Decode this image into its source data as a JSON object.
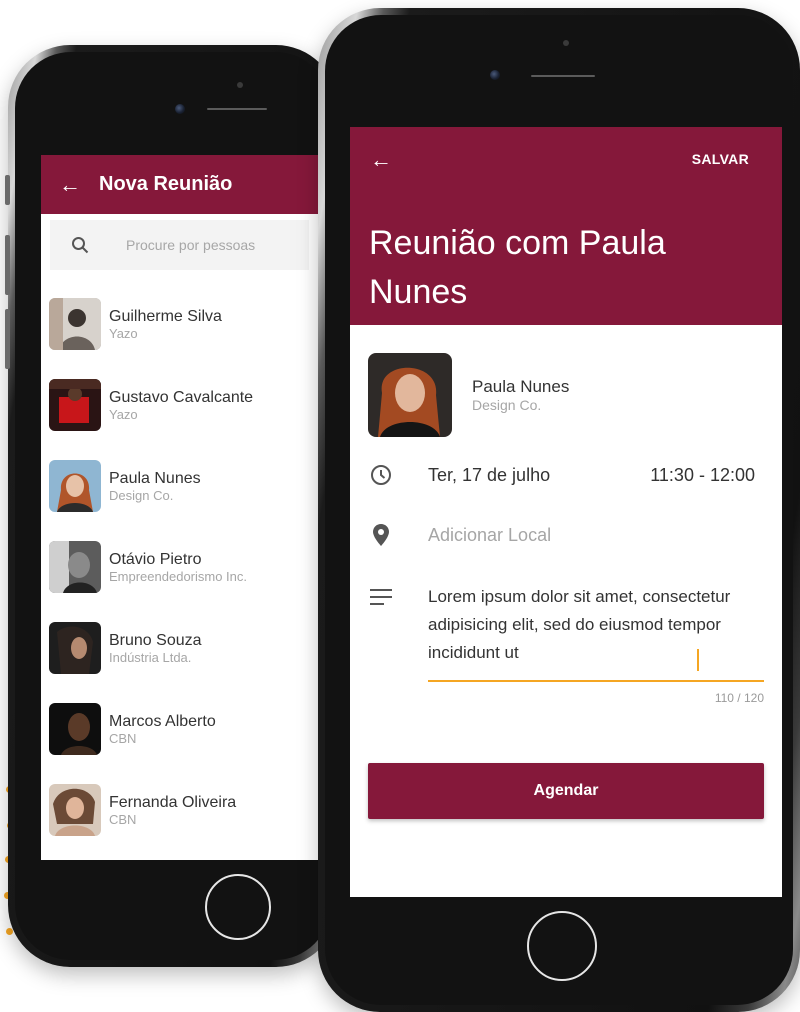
{
  "left_screen": {
    "title": "Nova Reunião",
    "search": {
      "placeholder": "Procure por pessoas"
    },
    "contacts": [
      {
        "name": "Guilherme Silva",
        "org": "Yazo"
      },
      {
        "name": "Gustavo Cavalcante",
        "org": "Yazo"
      },
      {
        "name": "Paula Nunes",
        "org": "Design Co."
      },
      {
        "name": "Otávio Pietro",
        "org": "Empreendedorismo Inc."
      },
      {
        "name": "Bruno Souza",
        "org": "Indústria Ltda."
      },
      {
        "name": "Marcos Alberto",
        "org": "CBN"
      },
      {
        "name": "Fernanda Oliveira",
        "org": "CBN"
      }
    ]
  },
  "right_screen": {
    "save_label": "SALVAR",
    "headline": "Reunião com Paula Nunes",
    "person": {
      "name": "Paula Nunes",
      "org": "Design Co."
    },
    "date": "Ter, 17 de julho",
    "time": "11:30 - 12:00",
    "location_placeholder": "Adicionar Local",
    "description": "Lorem ipsum dolor sit amet, consectetur adipisicing elit, sed do eiusmod tempor incididunt ut",
    "char_counter": "110 / 120",
    "submit_label": "Agendar"
  },
  "colors": {
    "primary": "#85183a",
    "accent": "#f5a623"
  },
  "icons": [
    "back-arrow-icon",
    "search-icon",
    "clock-icon",
    "location-pin-icon",
    "notes-icon"
  ]
}
